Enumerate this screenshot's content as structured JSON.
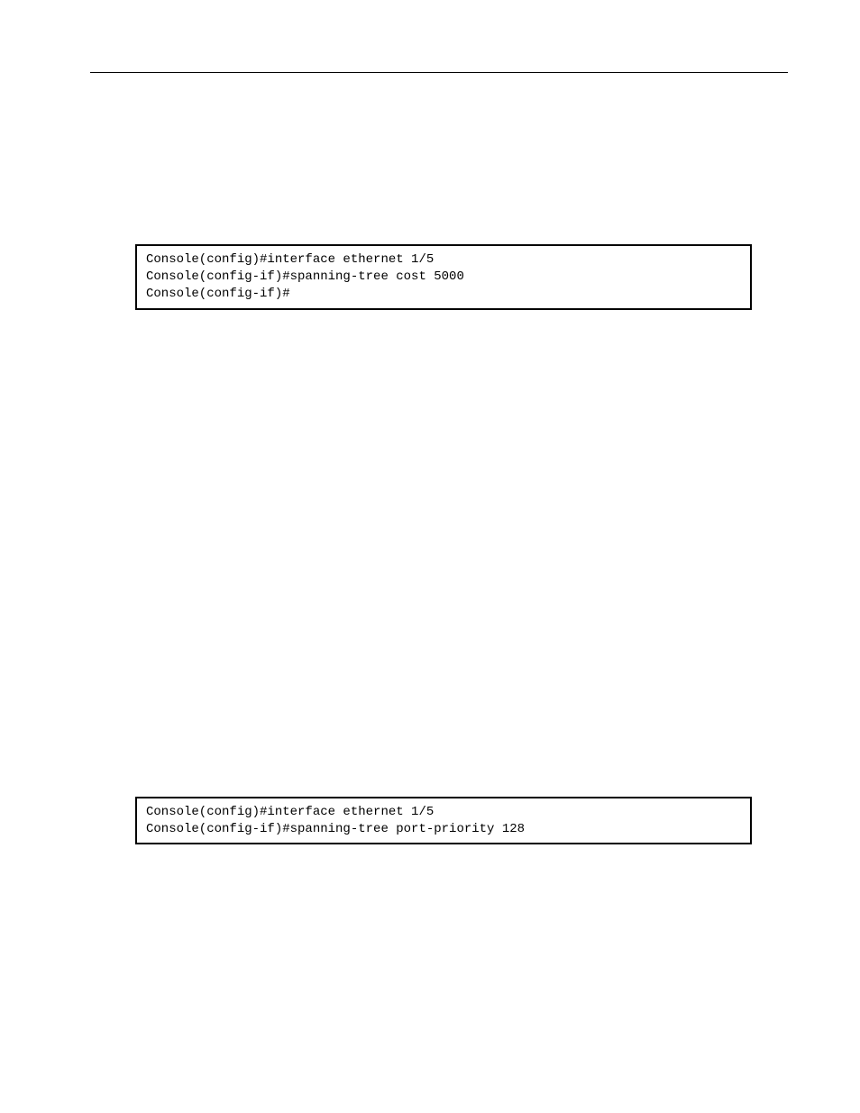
{
  "console1": {
    "line1": "Console(config)#interface ethernet 1/5",
    "line2": "Console(config-if)#spanning-tree cost 5000",
    "line3": "Console(config-if)#"
  },
  "console2": {
    "line1": "Console(config)#interface ethernet 1/5",
    "line2": "Console(config-if)#spanning-tree port-priority 128"
  }
}
